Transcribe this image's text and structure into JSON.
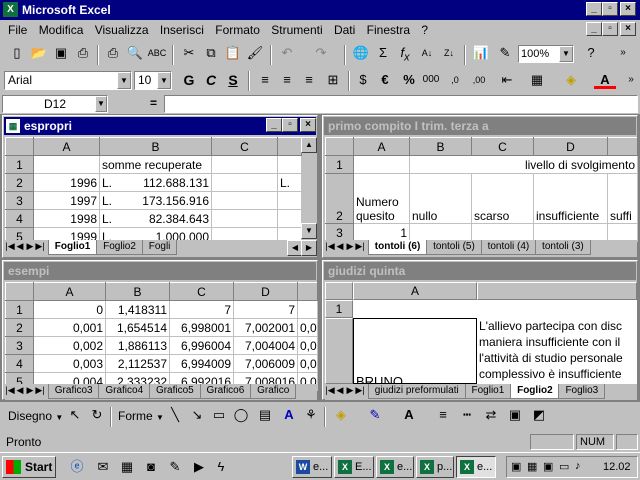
{
  "app": {
    "title": "Microsoft Excel"
  },
  "menu": [
    "File",
    "Modifica",
    "Visualizza",
    "Inserisci",
    "Formato",
    "Strumenti",
    "Dati",
    "Finestra",
    "?"
  ],
  "toolbar": {
    "zoom": "100%",
    "sigma": "Σ",
    "fx": "f",
    "fx_sub": "x"
  },
  "format_bar": {
    "font": "Arial",
    "size": "10",
    "bold": "G",
    "italic": "C",
    "underline": "S",
    "euro": "€",
    "percent": "%",
    "thousands": "000",
    "dec_inc": ",0",
    "dec_inc2": ",00"
  },
  "formula_bar": {
    "cell_ref": "D12",
    "equals": "="
  },
  "windows": {
    "espropri": {
      "title": "espropri",
      "cols": [
        "A",
        "B",
        "C"
      ],
      "rows": [
        {
          "n": "1",
          "a": "",
          "b1": "somme recuperate",
          "b2": "",
          "c": "",
          "d": ""
        },
        {
          "n": "2",
          "a": "1996",
          "b1": "L.",
          "b2": "112.688.131",
          "c": "",
          "d": "L."
        },
        {
          "n": "3",
          "a": "1997",
          "b1": "L.",
          "b2": "173.156.916",
          "c": "",
          "d": ""
        },
        {
          "n": "4",
          "a": "1998",
          "b1": "L.",
          "b2": "82.384.643",
          "c": "",
          "d": ""
        },
        {
          "n": "5",
          "a": "1999",
          "b1": "L.",
          "b2": "1.000.000",
          "c": "",
          "d": ""
        }
      ],
      "tabs": [
        "Foglio1",
        "Foglio2",
        "Fogli"
      ]
    },
    "primo": {
      "title": "primo compito I trim. terza a",
      "cols": [
        "A",
        "B",
        "C",
        "D"
      ],
      "row1_text": "livello di svolgimento",
      "row2": [
        "Numero quesito",
        "nullo",
        "scarso",
        "insufficiente",
        "suffi"
      ],
      "row3": [
        "1"
      ],
      "tabs": [
        "tontoli (6)",
        "tontoli (5)",
        "tontoli (4)",
        "tontoli (3)"
      ]
    },
    "esempi": {
      "title": "esempi",
      "cols": [
        "A",
        "B",
        "C",
        "D"
      ],
      "rows": [
        {
          "n": "1",
          "a": "0",
          "b": "1,418311",
          "c": "7",
          "d": "7",
          "e": ""
        },
        {
          "n": "2",
          "a": "0,001",
          "b": "1,654514",
          "c": "6,998001",
          "d": "7,002001",
          "e": "0,0"
        },
        {
          "n": "3",
          "a": "0,002",
          "b": "1,886113",
          "c": "6,996004",
          "d": "7,004004",
          "e": "0,0"
        },
        {
          "n": "4",
          "a": "0,003",
          "b": "2,112537",
          "c": "6,994009",
          "d": "7,006009",
          "e": "0,0"
        },
        {
          "n": "5",
          "a": "0,004",
          "b": "2,333232",
          "c": "6,992016",
          "d": "7,008016",
          "e": "0,0"
        }
      ],
      "tabs": [
        "Grafico3",
        "Grafico4",
        "Grafico5",
        "Grafico6",
        "Grafico"
      ]
    },
    "giudizi": {
      "title": "giudizi quinta",
      "col": "A",
      "name": "BRUNO",
      "lines": [
        "L'allievo partecipa con disc",
        "maniera insufficiente con il",
        "l'attività di studio personale",
        "complessivo è insufficiente"
      ],
      "tabs": [
        "giudizi preformulati",
        "Foglio1",
        "Foglio2",
        "Foglio3"
      ]
    }
  },
  "drawing_bar": {
    "draw": "Disegno",
    "shapes": "Forme"
  },
  "status": {
    "text": "Pronto",
    "num": "NUM"
  },
  "taskbar": {
    "start": "Start",
    "tasks": [
      "e...",
      "E...",
      "e...",
      "p...",
      "e..."
    ],
    "clock": "12.02"
  },
  "colors": {
    "title_active": "#000080",
    "title_inactive": "#808080",
    "face": "#c0c0c0"
  }
}
